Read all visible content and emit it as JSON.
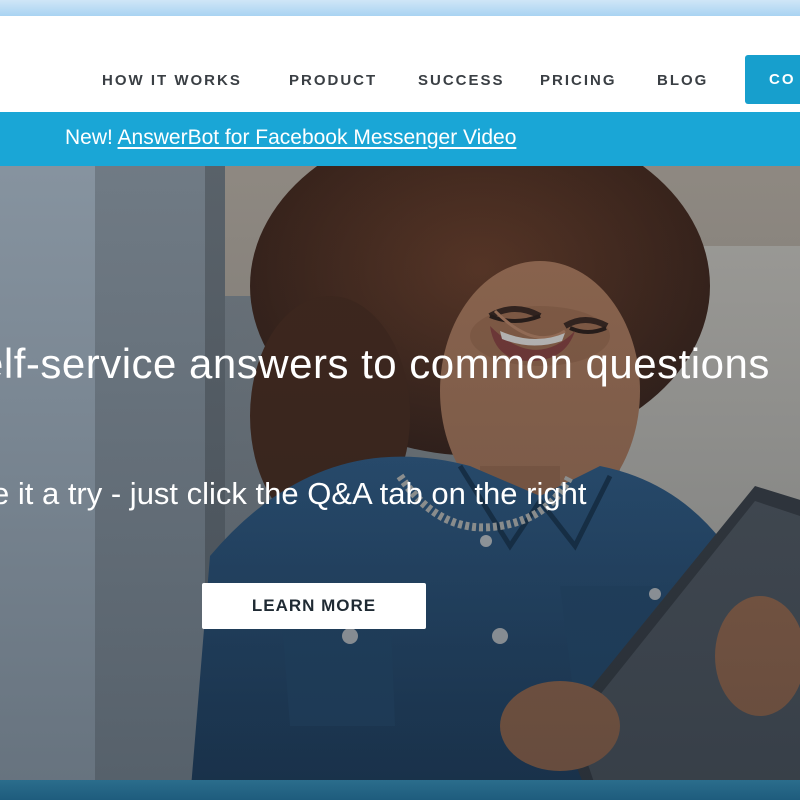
{
  "nav": {
    "items": [
      "HOW IT WORKS",
      "PRODUCT",
      "SUCCESS",
      "PRICING",
      "BLOG"
    ],
    "cta_label": "CO"
  },
  "announcement": {
    "prefix": "New!",
    "link_text": "AnswerBot for Facebook Messenger Video"
  },
  "hero": {
    "title": "elf-service answers to common questions",
    "subtitle": "e it a try - just click the Q&A tab on the right",
    "button_label": "LEARN MORE"
  },
  "colors": {
    "accent": "#1aa6d6",
    "nav_text": "#3a3f44"
  }
}
